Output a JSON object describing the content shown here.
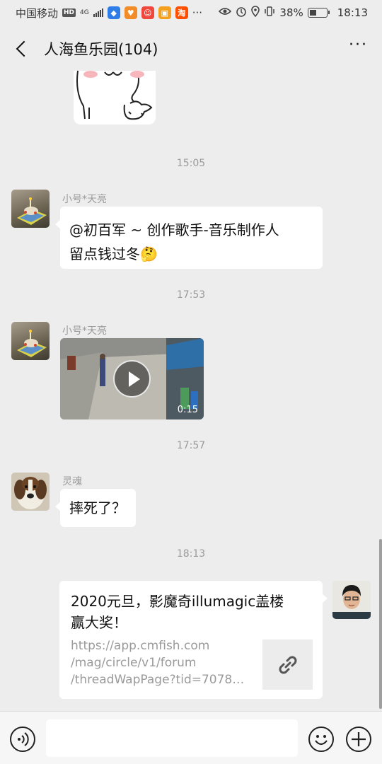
{
  "status_bar": {
    "carrier": "中国移动",
    "network_badge": "HD",
    "signal_type": "4G",
    "app_icons": [
      {
        "name": "blue-shield-app-icon",
        "color": "#2f7ee8",
        "glyph": "◆"
      },
      {
        "name": "orange-app-icon",
        "color": "#f28c28",
        "glyph": "♥"
      },
      {
        "name": "red-app-icon",
        "color": "#f0483c",
        "glyph": "☺"
      },
      {
        "name": "gift-app-icon",
        "color": "#f4a01e",
        "glyph": "▣"
      },
      {
        "name": "taobao-app-icon",
        "color": "#ff5000",
        "glyph": "淘"
      }
    ],
    "overflow": "···",
    "battery_percent": "38%",
    "time": "18:13"
  },
  "header": {
    "title": "人海鱼乐园(104)",
    "more_label": "···"
  },
  "messages": {
    "ts1": "15:05",
    "msg1": {
      "sender": "小号*天亮",
      "text_line1": "@初百军 ~ 创作歌手-音乐制作人",
      "text_line2": "留点钱过冬🤔"
    },
    "ts2": "17:53",
    "msg2": {
      "sender": "小号*天亮",
      "video_duration": "0:15"
    },
    "ts3": "17:57",
    "msg3": {
      "sender": "灵魂",
      "text": "摔死了？"
    },
    "ts4": "18:13",
    "msg4": {
      "link_title_line1": "2020元旦，影魔奇illumagic盖楼",
      "link_title_line2": "赢大奖！",
      "url_line1": "https://app.cmfish.com",
      "url_line2": "/mag/circle/v1/forum",
      "url_line3": "/threadWapPage?tid=70785…"
    }
  },
  "input_bar": {
    "voice_icon": "voice-icon",
    "emoji_icon": "emoji-icon",
    "add_icon": "plus-icon"
  }
}
